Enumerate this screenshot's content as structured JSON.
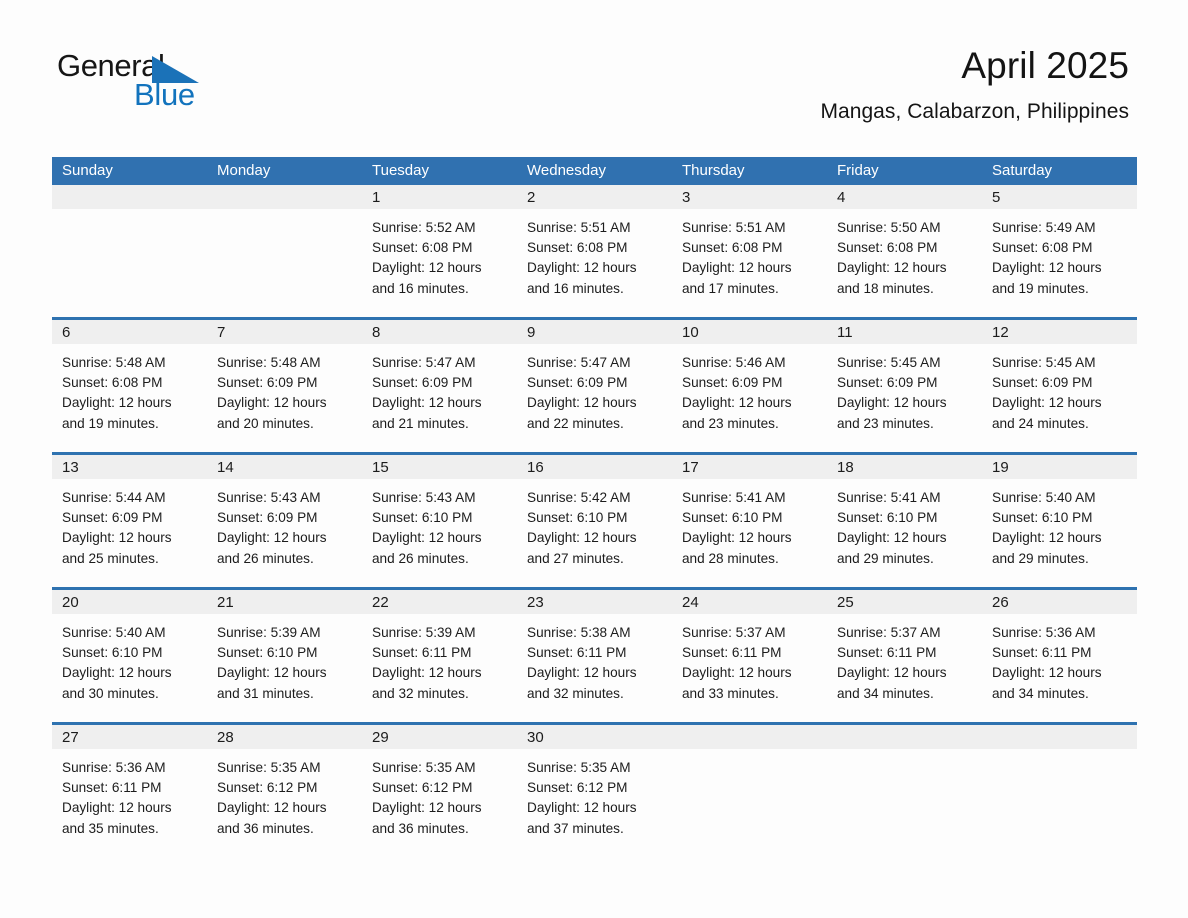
{
  "brand": {
    "name_part1": "General",
    "name_part2": "Blue",
    "triangle_color": "#1b72b8",
    "blue_color": "#1273bd"
  },
  "header": {
    "title": "April 2025",
    "subtitle": "Mangas, Calabarzon, Philippines"
  },
  "theme": {
    "header_blue": "#3071b0",
    "divider_blue": "#2e72b0",
    "date_band_gray": "#efefef",
    "page_background": "#fdfdfd",
    "text_color": "#1c1c1c"
  },
  "calendar": {
    "weekday_headers": [
      "Sunday",
      "Monday",
      "Tuesday",
      "Wednesday",
      "Thursday",
      "Friday",
      "Saturday"
    ],
    "weeks": [
      [
        {
          "date": "",
          "lines": []
        },
        {
          "date": "",
          "lines": []
        },
        {
          "date": "1",
          "lines": [
            "Sunrise: 5:52 AM",
            "Sunset: 6:08 PM",
            "Daylight: 12 hours and 16 minutes."
          ]
        },
        {
          "date": "2",
          "lines": [
            "Sunrise: 5:51 AM",
            "Sunset: 6:08 PM",
            "Daylight: 12 hours and 16 minutes."
          ]
        },
        {
          "date": "3",
          "lines": [
            "Sunrise: 5:51 AM",
            "Sunset: 6:08 PM",
            "Daylight: 12 hours and 17 minutes."
          ]
        },
        {
          "date": "4",
          "lines": [
            "Sunrise: 5:50 AM",
            "Sunset: 6:08 PM",
            "Daylight: 12 hours and 18 minutes."
          ]
        },
        {
          "date": "5",
          "lines": [
            "Sunrise: 5:49 AM",
            "Sunset: 6:08 PM",
            "Daylight: 12 hours and 19 minutes."
          ]
        }
      ],
      [
        {
          "date": "6",
          "lines": [
            "Sunrise: 5:48 AM",
            "Sunset: 6:08 PM",
            "Daylight: 12 hours and 19 minutes."
          ]
        },
        {
          "date": "7",
          "lines": [
            "Sunrise: 5:48 AM",
            "Sunset: 6:09 PM",
            "Daylight: 12 hours and 20 minutes."
          ]
        },
        {
          "date": "8",
          "lines": [
            "Sunrise: 5:47 AM",
            "Sunset: 6:09 PM",
            "Daylight: 12 hours and 21 minutes."
          ]
        },
        {
          "date": "9",
          "lines": [
            "Sunrise: 5:47 AM",
            "Sunset: 6:09 PM",
            "Daylight: 12 hours and 22 minutes."
          ]
        },
        {
          "date": "10",
          "lines": [
            "Sunrise: 5:46 AM",
            "Sunset: 6:09 PM",
            "Daylight: 12 hours and 23 minutes."
          ]
        },
        {
          "date": "11",
          "lines": [
            "Sunrise: 5:45 AM",
            "Sunset: 6:09 PM",
            "Daylight: 12 hours and 23 minutes."
          ]
        },
        {
          "date": "12",
          "lines": [
            "Sunrise: 5:45 AM",
            "Sunset: 6:09 PM",
            "Daylight: 12 hours and 24 minutes."
          ]
        }
      ],
      [
        {
          "date": "13",
          "lines": [
            "Sunrise: 5:44 AM",
            "Sunset: 6:09 PM",
            "Daylight: 12 hours and 25 minutes."
          ]
        },
        {
          "date": "14",
          "lines": [
            "Sunrise: 5:43 AM",
            "Sunset: 6:09 PM",
            "Daylight: 12 hours and 26 minutes."
          ]
        },
        {
          "date": "15",
          "lines": [
            "Sunrise: 5:43 AM",
            "Sunset: 6:10 PM",
            "Daylight: 12 hours and 26 minutes."
          ]
        },
        {
          "date": "16",
          "lines": [
            "Sunrise: 5:42 AM",
            "Sunset: 6:10 PM",
            "Daylight: 12 hours and 27 minutes."
          ]
        },
        {
          "date": "17",
          "lines": [
            "Sunrise: 5:41 AM",
            "Sunset: 6:10 PM",
            "Daylight: 12 hours and 28 minutes."
          ]
        },
        {
          "date": "18",
          "lines": [
            "Sunrise: 5:41 AM",
            "Sunset: 6:10 PM",
            "Daylight: 12 hours and 29 minutes."
          ]
        },
        {
          "date": "19",
          "lines": [
            "Sunrise: 5:40 AM",
            "Sunset: 6:10 PM",
            "Daylight: 12 hours and 29 minutes."
          ]
        }
      ],
      [
        {
          "date": "20",
          "lines": [
            "Sunrise: 5:40 AM",
            "Sunset: 6:10 PM",
            "Daylight: 12 hours and 30 minutes."
          ]
        },
        {
          "date": "21",
          "lines": [
            "Sunrise: 5:39 AM",
            "Sunset: 6:10 PM",
            "Daylight: 12 hours and 31 minutes."
          ]
        },
        {
          "date": "22",
          "lines": [
            "Sunrise: 5:39 AM",
            "Sunset: 6:11 PM",
            "Daylight: 12 hours and 32 minutes."
          ]
        },
        {
          "date": "23",
          "lines": [
            "Sunrise: 5:38 AM",
            "Sunset: 6:11 PM",
            "Daylight: 12 hours and 32 minutes."
          ]
        },
        {
          "date": "24",
          "lines": [
            "Sunrise: 5:37 AM",
            "Sunset: 6:11 PM",
            "Daylight: 12 hours and 33 minutes."
          ]
        },
        {
          "date": "25",
          "lines": [
            "Sunrise: 5:37 AM",
            "Sunset: 6:11 PM",
            "Daylight: 12 hours and 34 minutes."
          ]
        },
        {
          "date": "26",
          "lines": [
            "Sunrise: 5:36 AM",
            "Sunset: 6:11 PM",
            "Daylight: 12 hours and 34 minutes."
          ]
        }
      ],
      [
        {
          "date": "27",
          "lines": [
            "Sunrise: 5:36 AM",
            "Sunset: 6:11 PM",
            "Daylight: 12 hours and 35 minutes."
          ]
        },
        {
          "date": "28",
          "lines": [
            "Sunrise: 5:35 AM",
            "Sunset: 6:12 PM",
            "Daylight: 12 hours and 36 minutes."
          ]
        },
        {
          "date": "29",
          "lines": [
            "Sunrise: 5:35 AM",
            "Sunset: 6:12 PM",
            "Daylight: 12 hours and 36 minutes."
          ]
        },
        {
          "date": "30",
          "lines": [
            "Sunrise: 5:35 AM",
            "Sunset: 6:12 PM",
            "Daylight: 12 hours and 37 minutes."
          ]
        },
        {
          "date": "",
          "lines": []
        },
        {
          "date": "",
          "lines": []
        },
        {
          "date": "",
          "lines": []
        }
      ]
    ]
  }
}
